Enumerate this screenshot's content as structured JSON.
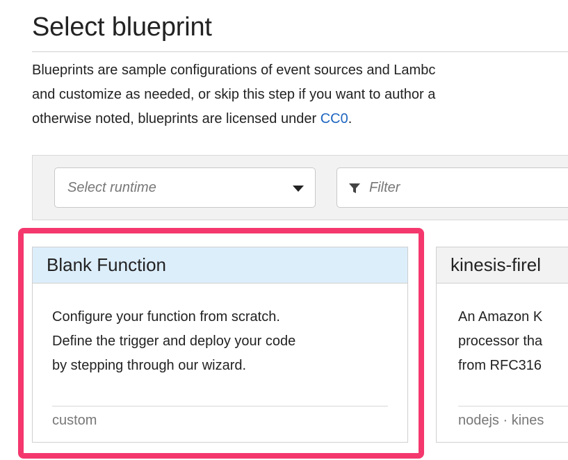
{
  "page": {
    "title": "Select blueprint",
    "description_lines": [
      "Blueprints are sample configurations of event sources and Lambc",
      "and customize as needed, or skip this step if you want to author a",
      "otherwise noted, blueprints are licensed under "
    ],
    "license_link": "CC0",
    "license_suffix": "."
  },
  "toolbar": {
    "runtime_placeholder": "Select runtime",
    "filter_placeholder": "Filter"
  },
  "cards": [
    {
      "name": "Blank Function",
      "description_lines": [
        "Configure your function from scratch.",
        "Define the trigger and deploy your code",
        "by stepping through our wizard."
      ],
      "tags": "custom",
      "selected": true
    },
    {
      "name": "kinesis-firel",
      "description_lines": [
        "An Amazon K",
        "processor tha",
        "from RFC316"
      ],
      "tags": "nodejs · kines",
      "selected": false
    }
  ],
  "colors": {
    "highlight": "#f4386e",
    "selected_header": "#ddeefb",
    "link": "#1f66c0"
  }
}
